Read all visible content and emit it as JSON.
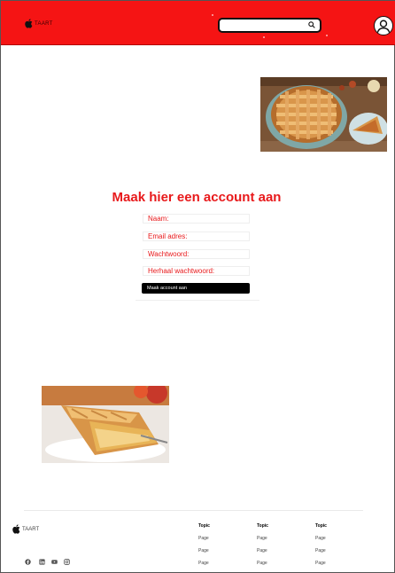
{
  "header": {
    "brand_text": "TAART",
    "search_value": "",
    "colors": {
      "bar": "#f51414"
    }
  },
  "images": {
    "top": "lattice-pie-photo",
    "bottom": "apple-pie-slice-photo"
  },
  "form": {
    "title": "Maak hier een account aan",
    "fields": {
      "name": "Naam:",
      "email": "Email adres:",
      "password": "Wachtwoord:",
      "repeat_password": "Herhaal wachtwoord:"
    },
    "submit_label": "Maak account aan",
    "accent": "#e8191b"
  },
  "footer": {
    "brand_text": "TAART",
    "social_icons": [
      "facebook-icon",
      "linkedin-icon",
      "youtube-icon",
      "instagram-icon"
    ],
    "columns": [
      {
        "topic": "Topic",
        "pages": [
          "Page",
          "Page",
          "Page"
        ]
      },
      {
        "topic": "Topic",
        "pages": [
          "Page",
          "Page",
          "Page"
        ]
      },
      {
        "topic": "Topic",
        "pages": [
          "Page",
          "Page",
          "Page"
        ]
      }
    ]
  }
}
